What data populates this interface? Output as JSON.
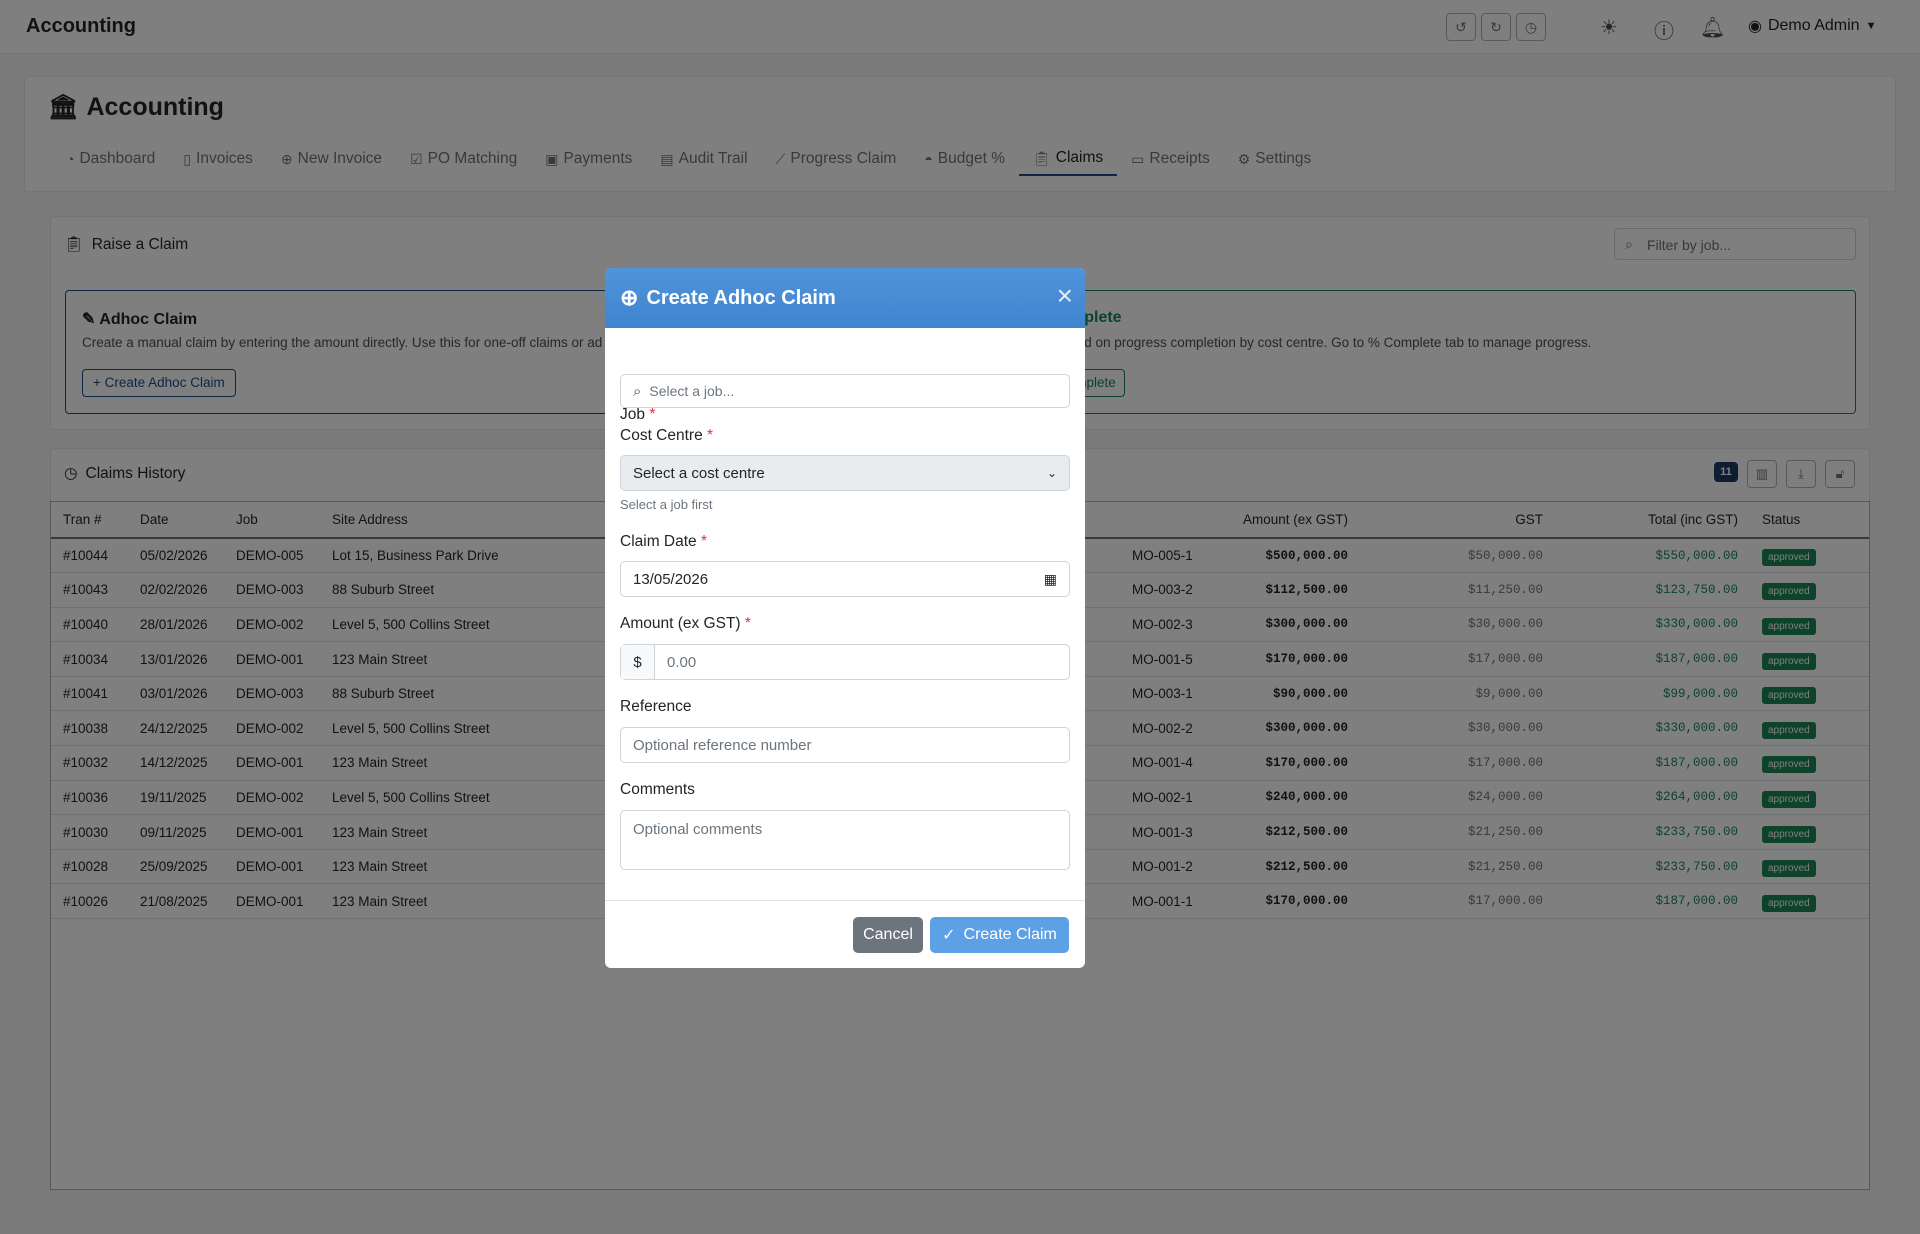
{
  "topbar": {
    "title": "Accounting",
    "user": "Demo Admin"
  },
  "page": {
    "title": "Accounting"
  },
  "tabs": [
    {
      "label": "Dashboard"
    },
    {
      "label": "Invoices"
    },
    {
      "label": "New Invoice"
    },
    {
      "label": "PO Matching"
    },
    {
      "label": "Payments"
    },
    {
      "label": "Audit Trail"
    },
    {
      "label": "Progress Claim"
    },
    {
      "label": "Budget %"
    },
    {
      "label": "Claims"
    },
    {
      "label": "Receipts"
    },
    {
      "label": "Settings"
    }
  ],
  "raise": {
    "title": "Raise a Claim",
    "filter_placeholder": "Filter by job...",
    "adhoc": {
      "title": "Adhoc Claim",
      "desc": "Create a manual claim by entering the amount directly. Use this for one-off claims or ad",
      "button": "+ Create Adhoc Claim"
    },
    "complete": {
      "title": "mplete",
      "desc": "sed on progress completion by cost centre. Go to % Complete tab to manage progress.",
      "button": "nplete"
    }
  },
  "history": {
    "title": "Claims History",
    "count": "11",
    "columns": [
      "Tran #",
      "Date",
      "Job",
      "Site Address",
      "",
      "Amount (ex GST)",
      "GST",
      "Total (inc GST)",
      "Status"
    ],
    "rows": [
      {
        "tran": "#10044",
        "date": "05/02/2026",
        "job": "DEMO-005",
        "site": "Lot 15, Business Park Drive",
        "cc": "MO-005-1",
        "amount": "$500,000.00",
        "gst": "$50,000.00",
        "total": "$550,000.00",
        "status": "approved"
      },
      {
        "tran": "#10043",
        "date": "02/02/2026",
        "job": "DEMO-003",
        "site": "88 Suburb Street",
        "cc": "MO-003-2",
        "amount": "$112,500.00",
        "gst": "$11,250.00",
        "total": "$123,750.00",
        "status": "approved"
      },
      {
        "tran": "#10040",
        "date": "28/01/2026",
        "job": "DEMO-002",
        "site": "Level 5, 500 Collins Street",
        "cc": "MO-002-3",
        "amount": "$300,000.00",
        "gst": "$30,000.00",
        "total": "$330,000.00",
        "status": "approved"
      },
      {
        "tran": "#10034",
        "date": "13/01/2026",
        "job": "DEMO-001",
        "site": "123 Main Street",
        "cc": "MO-001-5",
        "amount": "$170,000.00",
        "gst": "$17,000.00",
        "total": "$187,000.00",
        "status": "approved"
      },
      {
        "tran": "#10041",
        "date": "03/01/2026",
        "job": "DEMO-003",
        "site": "88 Suburb Street",
        "cc": "MO-003-1",
        "amount": "$90,000.00",
        "gst": "$9,000.00",
        "total": "$99,000.00",
        "status": "approved"
      },
      {
        "tran": "#10038",
        "date": "24/12/2025",
        "job": "DEMO-002",
        "site": "Level 5, 500 Collins Street",
        "cc": "MO-002-2",
        "amount": "$300,000.00",
        "gst": "$30,000.00",
        "total": "$330,000.00",
        "status": "approved"
      },
      {
        "tran": "#10032",
        "date": "14/12/2025",
        "job": "DEMO-001",
        "site": "123 Main Street",
        "cc": "MO-001-4",
        "amount": "$170,000.00",
        "gst": "$17,000.00",
        "total": "$187,000.00",
        "status": "approved"
      },
      {
        "tran": "#10036",
        "date": "19/11/2025",
        "job": "DEMO-002",
        "site": "Level 5, 500 Collins Street",
        "cc": "MO-002-1",
        "amount": "$240,000.00",
        "gst": "$24,000.00",
        "total": "$264,000.00",
        "status": "approved"
      },
      {
        "tran": "#10030",
        "date": "09/11/2025",
        "job": "DEMO-001",
        "site": "123 Main Street",
        "cc": "MO-001-3",
        "amount": "$212,500.00",
        "gst": "$21,250.00",
        "total": "$233,750.00",
        "status": "approved"
      },
      {
        "tran": "#10028",
        "date": "25/09/2025",
        "job": "DEMO-001",
        "site": "123 Main Street",
        "cc": "MO-001-2",
        "amount": "$212,500.00",
        "gst": "$21,250.00",
        "total": "$233,750.00",
        "status": "approved"
      },
      {
        "tran": "#10026",
        "date": "21/08/2025",
        "job": "DEMO-001",
        "site": "123 Main Street",
        "cc": "MO-001-1",
        "amount": "$170,000.00",
        "gst": "$17,000.00",
        "total": "$187,000.00",
        "status": "approved"
      }
    ]
  },
  "modal": {
    "title": "Create Adhoc Claim",
    "job_label": "Job",
    "job_placeholder": "Select a job...",
    "cc_label": "Cost Centre",
    "cc_value": "Select a cost centre",
    "cc_hint": "Select a job first",
    "date_label": "Claim Date",
    "date_value": "13/05/2026",
    "amount_label": "Amount (ex GST)",
    "currency": "$",
    "amount_placeholder": "0.00",
    "ref_label": "Reference",
    "ref_placeholder": "Optional reference number",
    "comments_label": "Comments",
    "comments_placeholder": "Optional comments",
    "cancel": "Cancel",
    "create": "Create Claim",
    "required_mark": "*"
  },
  "colors": {
    "primary": "#1f4e8c",
    "success": "#198754",
    "modal_header": "#4a8fd8"
  }
}
